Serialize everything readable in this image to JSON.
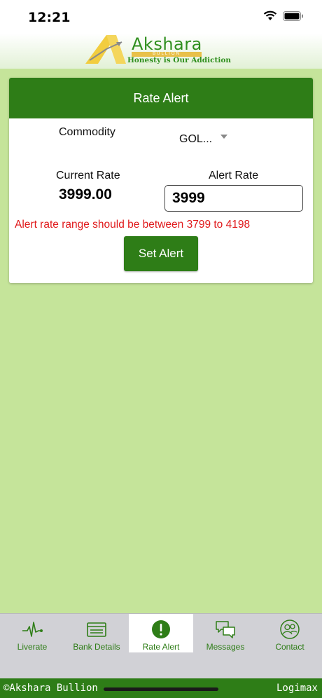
{
  "status_bar": {
    "time": "12:21"
  },
  "header": {
    "logo_name": "Akshara",
    "logo_sub": "BULLION",
    "logo_tagline": "Honesty is Our Addiction"
  },
  "card": {
    "title": "Rate Alert",
    "commodity_label": "Commodity",
    "commodity_value": "GOL...",
    "current_rate_label": "Current Rate",
    "current_rate_value": "3999.00",
    "alert_rate_label": "Alert Rate",
    "alert_rate_value": "3999",
    "error_message": "Alert rate range should be between 3799 to 4198",
    "set_button": "Set Alert"
  },
  "tabs": [
    {
      "label": "Liverate",
      "icon": "pulse-icon"
    },
    {
      "label": "Bank Details",
      "icon": "card-icon"
    },
    {
      "label": "Rate Alert",
      "icon": "alert-icon",
      "active": true
    },
    {
      "label": "Messages",
      "icon": "chat-bubbles-icon"
    },
    {
      "label": "Contact",
      "icon": "contact-icon"
    }
  ],
  "footer": {
    "copyright": "©Akshara Bullion",
    "brand": "Logimax"
  },
  "colors": {
    "primary": "#2e7d17",
    "background": "#c5e49a",
    "error": "#e0191b"
  }
}
